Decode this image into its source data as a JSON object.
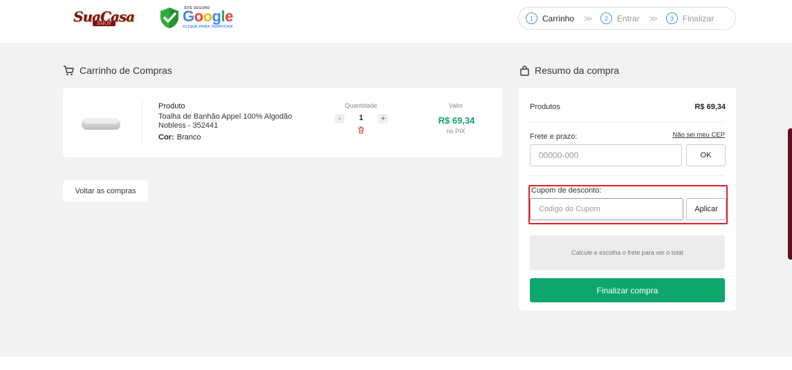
{
  "header": {
    "logo": {
      "main": "SuaCasa",
      "sub": "SHOP"
    },
    "security_badge": {
      "top": "SITE SEGURO",
      "brand": "Google",
      "bottom": "CLIQUE PARA VERIFICAR"
    },
    "steps": [
      {
        "number": "1",
        "label": "Carrinho",
        "active": true
      },
      {
        "number": "2",
        "label": "Entrar",
        "active": false
      },
      {
        "number": "3",
        "label": "Finalizar",
        "active": false
      }
    ],
    "step_separator": ">>"
  },
  "cart": {
    "title": "Carrinho de Compras",
    "item": {
      "product_label": "Produto",
      "name": "Toalha de Banhão Appel 100% Algodão Nobless - 352441",
      "color_label": "Cor:",
      "color_value": "Branco",
      "quantity_label": "Quantidade",
      "quantity_minus": "-",
      "quantity": "1",
      "quantity_plus": "+",
      "value_label": "Valor",
      "price": "R$ 69,34",
      "price_note": "no PIX"
    },
    "back_button": "Voltar as compras"
  },
  "summary": {
    "title": "Resumo da compra",
    "products_label": "Produtos",
    "products_value": "R$ 69,34",
    "shipping_label": "Frete e prazo:",
    "no_cep_link": "Não sei meu CEP",
    "cep_placeholder": "00000-000",
    "ok_button": "OK",
    "coupon_label": "Cupom de desconto:",
    "coupon_placeholder": "Código do Cupom",
    "apply_button": "Aplicar",
    "calc_note": "Calcule e escolha o frete para ver o total",
    "finish_button": "Finalizar compra"
  },
  "colors": {
    "accent_green": "#0ea66c",
    "price_green": "#11a06a",
    "highlight_red": "#e02020",
    "step_blue": "#4a90e2",
    "brand_maroon": "#7a1020"
  }
}
